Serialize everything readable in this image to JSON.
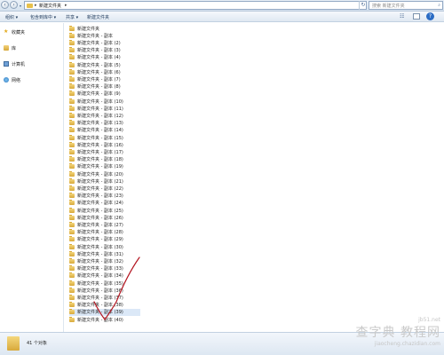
{
  "address_bar": {
    "breadcrumb": "新建文件夹",
    "search_placeholder": "搜索 新建文件夹"
  },
  "toolbar": {
    "organize": "组织 ▾",
    "include_in_library": "包含到库中 ▾",
    "share": "共享 ▾",
    "new_folder": "新建文件夹"
  },
  "sidebar": {
    "items": [
      {
        "label": "收藏夹",
        "icon": "star-icon"
      },
      {
        "label": "库",
        "icon": "library-icon"
      },
      {
        "label": "计算机",
        "icon": "computer-icon"
      },
      {
        "label": "网络",
        "icon": "network-icon"
      }
    ]
  },
  "files": [
    "新建文件夹",
    "新建文件夹 - 副本",
    "新建文件夹 - 副本 (2)",
    "新建文件夹 - 副本 (3)",
    "新建文件夹 - 副本 (4)",
    "新建文件夹 - 副本 (5)",
    "新建文件夹 - 副本 (6)",
    "新建文件夹 - 副本 (7)",
    "新建文件夹 - 副本 (8)",
    "新建文件夹 - 副本 (9)",
    "新建文件夹 - 副本 (10)",
    "新建文件夹 - 副本 (11)",
    "新建文件夹 - 副本 (12)",
    "新建文件夹 - 副本 (13)",
    "新建文件夹 - 副本 (14)",
    "新建文件夹 - 副本 (15)",
    "新建文件夹 - 副本 (16)",
    "新建文件夹 - 副本 (17)",
    "新建文件夹 - 副本 (18)",
    "新建文件夹 - 副本 (19)",
    "新建文件夹 - 副本 (20)",
    "新建文件夹 - 副本 (21)",
    "新建文件夹 - 副本 (22)",
    "新建文件夹 - 副本 (23)",
    "新建文件夹 - 副本 (24)",
    "新建文件夹 - 副本 (25)",
    "新建文件夹 - 副本 (26)",
    "新建文件夹 - 副本 (27)",
    "新建文件夹 - 副本 (28)",
    "新建文件夹 - 副本 (29)",
    "新建文件夹 - 副本 (30)",
    "新建文件夹 - 副本 (31)",
    "新建文件夹 - 副本 (32)",
    "新建文件夹 - 副本 (33)",
    "新建文件夹 - 副本 (34)",
    "新建文件夹 - 副本 (35)",
    "新建文件夹 - 副本 (36)",
    "新建文件夹 - 副本 (37)",
    "新建文件夹 - 副本 (38)",
    "新建文件夹 - 副本 (39)",
    "新建文件夹 - 副本 (40)"
  ],
  "status_bar": {
    "count_text": "41 个对象"
  },
  "watermark": {
    "logo": "查字典 教程网",
    "url": "jiaocheng.chazidian.com",
    "site": "jb51.net"
  }
}
